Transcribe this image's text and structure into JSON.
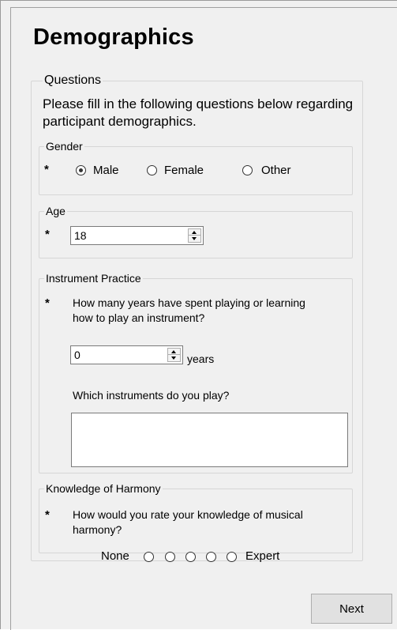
{
  "page": {
    "title": "Demographics"
  },
  "questions": {
    "legend": "Questions",
    "intro": "Please fill in the following questions below regarding participant demographics.",
    "required_mark": "*",
    "gender": {
      "legend": "Gender",
      "options": [
        {
          "label": "Male",
          "checked": true
        },
        {
          "label": "Female",
          "checked": false
        },
        {
          "label": "Other",
          "checked": false
        }
      ]
    },
    "age": {
      "legend": "Age",
      "value": "18"
    },
    "instrument": {
      "legend": "Instrument Practice",
      "question": "How many years have spent playing or learning how to play an instrument?",
      "years_value": "0",
      "years_unit": "years",
      "which_question": "Which instruments do you play?",
      "which_value": ""
    },
    "harmony": {
      "legend": "Knowledge of Harmony",
      "question": "How would you rate your knowledge of musical harmony?",
      "scale_min_label": "None",
      "scale_max_label": "Expert",
      "scale_points": 5
    }
  },
  "actions": {
    "next_label": "Next"
  }
}
